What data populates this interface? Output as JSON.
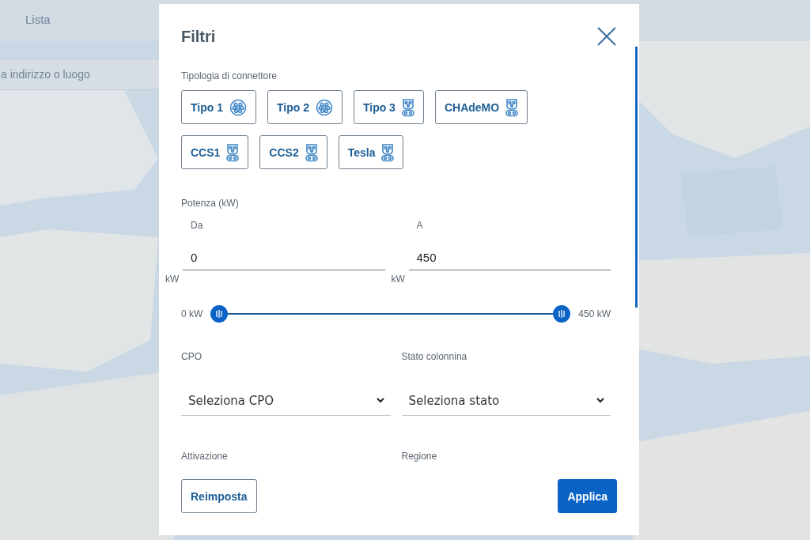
{
  "background": {
    "kind": "picture",
    "tabs": [
      {
        "label": "Lista",
        "selected": false
      }
    ],
    "search": {
      "placeholder": "a indirizzo o luogo"
    }
  },
  "dialog": {
    "title": "Filtri",
    "connector_label": "Tipologia di connettore",
    "connectors": [
      {
        "label": "Tipo 1",
        "kind": "round",
        "selected": false
      },
      {
        "label": "Tipo 2",
        "kind": "round",
        "selected": false
      },
      {
        "label": "Tipo 3",
        "kind": "combo",
        "selected": false
      },
      {
        "label": "CHAdeMO",
        "kind": "combo",
        "selected": false
      },
      {
        "label": "CCS1",
        "kind": "combo",
        "selected": false
      },
      {
        "label": "CCS2",
        "kind": "combo",
        "selected": false
      },
      {
        "label": "Tesla",
        "kind": "combo",
        "selected": false
      }
    ],
    "power": {
      "label": "Potenza (kW)",
      "from": {
        "label": "Da",
        "value": "0",
        "unit": "kW"
      },
      "to": {
        "label": "A",
        "value": "450",
        "unit": "kW"
      },
      "slider": {
        "min_label": "0 kW",
        "max_label": "450 kW",
        "low": {
          "level": 0
        },
        "high": {
          "level": 1
        }
      }
    },
    "selects": [
      {
        "label": "CPO",
        "value": "Seleziona CPO"
      },
      {
        "label": "Stato colonnina",
        "value": "Seleziona stato"
      }
    ],
    "more_labels": [
      "Attivazione",
      "Regione"
    ],
    "buttons": [
      {
        "label": "Reimposta",
        "kind": "secondary"
      },
      {
        "label": "Applica",
        "kind": "primary"
      }
    ]
  }
}
